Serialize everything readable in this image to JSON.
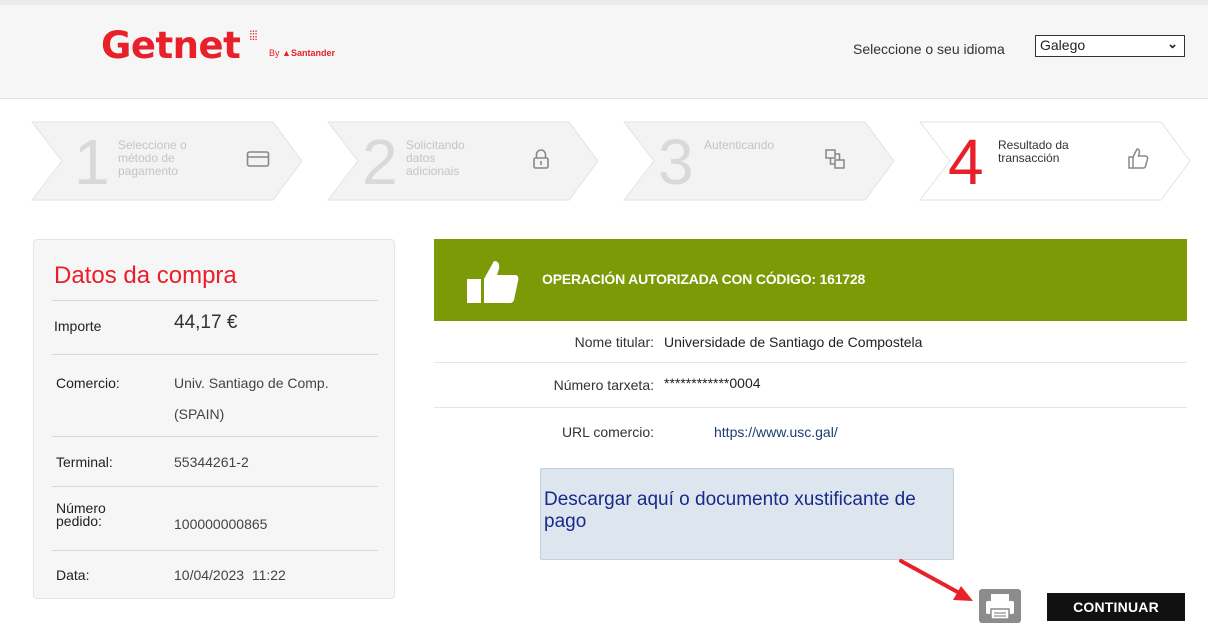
{
  "header": {
    "logo_text": "Getnet",
    "logo_by": "By",
    "logo_brand": "Santander",
    "language_label": "Seleccione o seu idioma",
    "language_value": "Galego"
  },
  "steps": [
    {
      "number": "1",
      "label_lines": [
        "Seleccione o",
        "método de",
        "pagamento"
      ],
      "icon": "card-icon",
      "active": false
    },
    {
      "number": "2",
      "label_lines": [
        "Solicitando",
        "datos",
        "adicionais"
      ],
      "icon": "lock-icon",
      "active": false
    },
    {
      "number": "3",
      "label_lines": [
        "Autenticando"
      ],
      "icon": "authenticate-icon",
      "active": false
    },
    {
      "number": "4",
      "label_lines": [
        "Resultado da",
        "transacción"
      ],
      "icon": "thumbs-up-icon",
      "active": true
    }
  ],
  "purchase": {
    "title": "Datos da compra",
    "amount_label": "Importe",
    "amount_value": "44,17 €",
    "merchant_label": "Comercio:",
    "merchant_value_line1": "Univ. Santiago de Comp.",
    "merchant_value_line2": "(SPAIN)",
    "terminal_label": "Terminal:",
    "terminal_value": "55344261-2",
    "order_label_line1": "Número",
    "order_label_line2": "pedido:",
    "order_value": "100000000865",
    "date_label": "Data:",
    "date_value": "10/04/2023  11:22"
  },
  "result": {
    "banner_text": "OPERACIÓN AUTORIZADA CON CÓDIGO: 161728",
    "holder_label": "Nome titular:",
    "holder_value": "Universidade de Santiago de Compostela",
    "card_label": "Número tarxeta:",
    "card_value": "************0004",
    "url_label": "URL comercio:",
    "url_value": "https://www.usc.gal/"
  },
  "note": {
    "text": "Descargar aquí o documento xustificante de pago"
  },
  "actions": {
    "continue_label": "CONTINUAR"
  },
  "colors": {
    "brand_red": "#e8202a",
    "success_green": "#7b9a06",
    "note_bg": "#dde6ef",
    "note_text": "#1a2a8a"
  }
}
